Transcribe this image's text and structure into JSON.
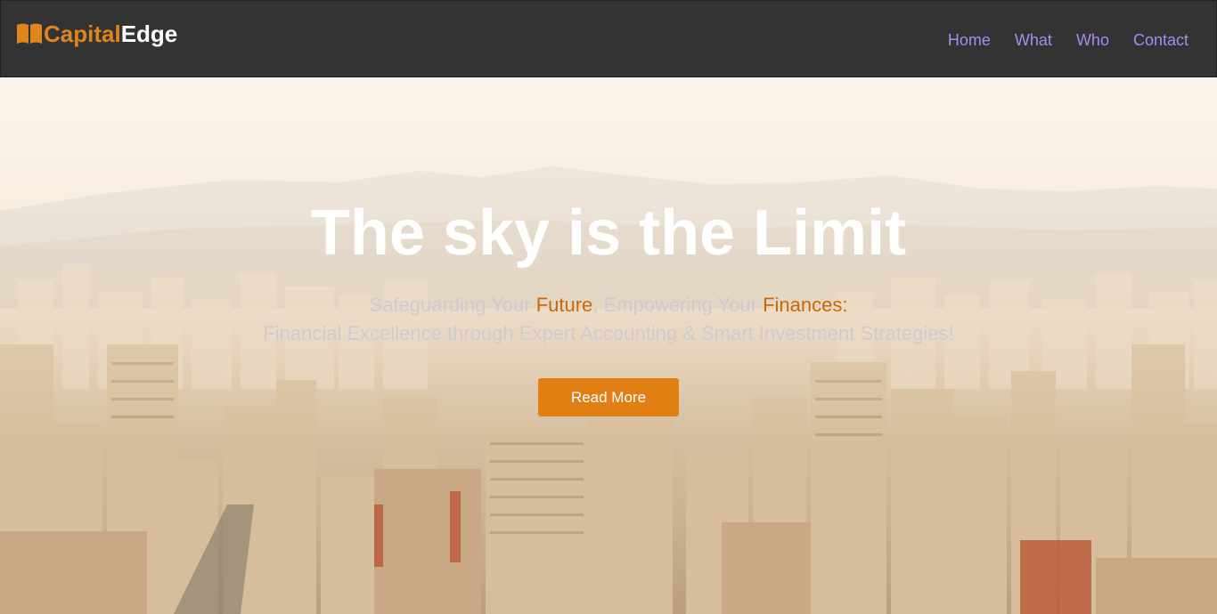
{
  "brand": {
    "part1": "Capital",
    "part2": "Edge",
    "icon": "book-icon",
    "accent_color": "#e0851c"
  },
  "nav": {
    "items": [
      {
        "label": "Home"
      },
      {
        "label": "What"
      },
      {
        "label": "Who"
      },
      {
        "label": "Contact"
      }
    ],
    "link_color": "#a78cf0"
  },
  "hero": {
    "headline": "The sky is the Limit",
    "tagline": {
      "line1_a": "Safeguarding Your ",
      "line1_b": "Future",
      "line1_c": ", Empowering Your ",
      "line1_d": "Finances",
      "line1_e": ":",
      "line2": "Financial Excellence through Expert Accounting & Smart Investment Strategies!"
    },
    "cta_label": "Read More",
    "cta_color": "#e07f14"
  }
}
